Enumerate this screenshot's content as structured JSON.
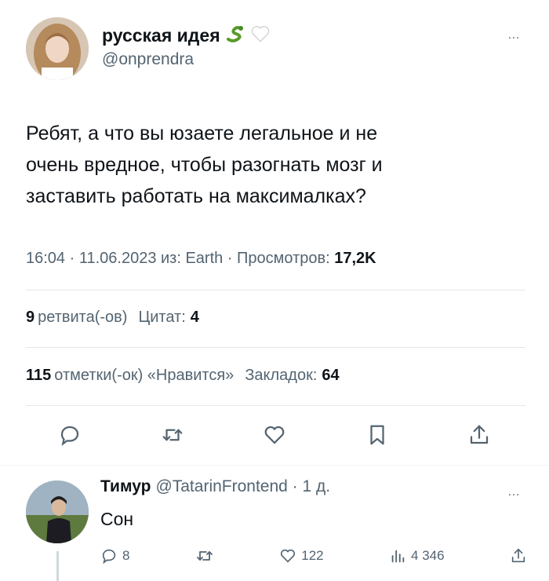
{
  "tweet": {
    "display_name": "русская идея",
    "name_emojis": [
      "snake-emoji",
      "white-heart-emoji"
    ],
    "handle": "@onprendra",
    "more_icon": "…",
    "text": "Ребят, а что вы юзаете легальное и не\nочень вредное, чтобы разогнать мозг и\nзаставить работать на максималках?",
    "meta_prefix": "16:04 · 11.06.2023 из: Earth · Просмотров: ",
    "views": "17,2K",
    "retweets_count": "9",
    "retweets_label": "ретвита(-ов)",
    "quotes_label": "Цитат:",
    "quotes_count": "4",
    "likes_count": "115",
    "likes_label": "отметки(-ок) «Нравится»",
    "bookmarks_label": "Закладок:",
    "bookmarks_count": "64",
    "action_icons": [
      "reply-icon",
      "retweet-icon",
      "like-icon",
      "bookmark-icon",
      "share-icon"
    ]
  },
  "reply": {
    "name": "Тимур",
    "handle_time": "@TatarinFrontend · 1 д.",
    "more_icon": "…",
    "text": "Сон",
    "replies": "8",
    "likes": "122",
    "views": "4 346"
  },
  "colors": {
    "text": "#0f1419",
    "secondary": "#536471",
    "divider": "#e4e8eb"
  }
}
